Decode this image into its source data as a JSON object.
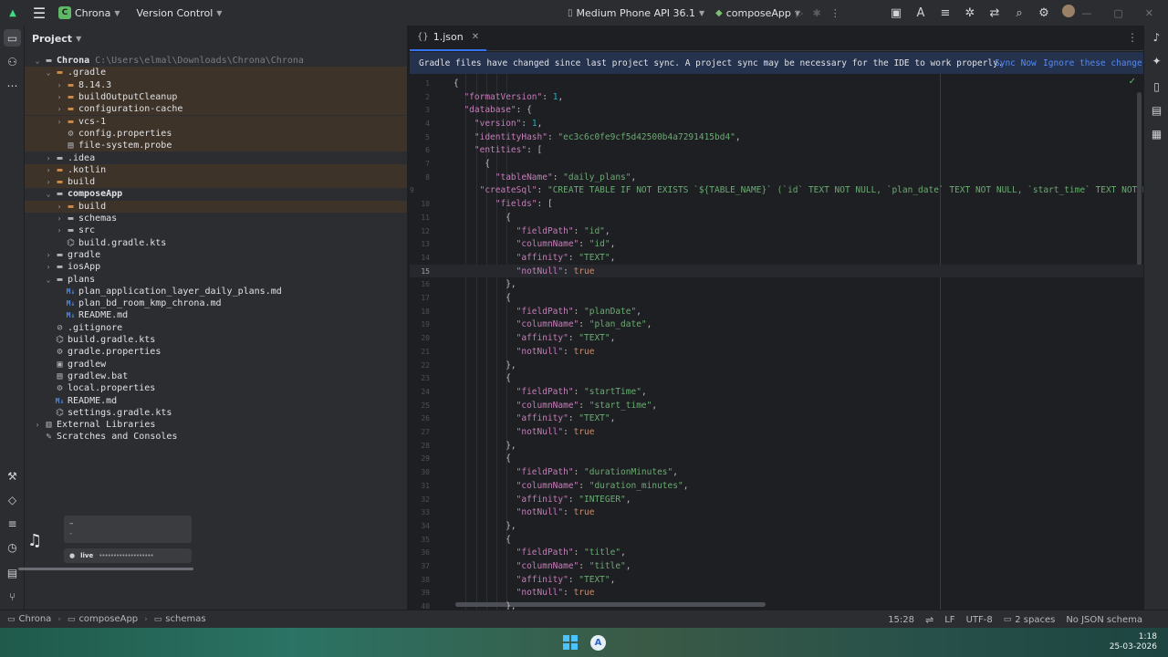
{
  "titlebar": {
    "project_badge": "C",
    "project_name": "Chrona",
    "version_control": "Version Control",
    "device": "Medium Phone API 36.1",
    "run_config": "composeApp"
  },
  "project_panel": {
    "title": "Project",
    "root_label": "Chrona",
    "root_path": "C:\\Users\\elmal\\Downloads\\Chrona\\Chrona",
    "items": [
      {
        "label": ".gradle",
        "indent": 2,
        "type": "folder-orange",
        "expanded": true,
        "ignored": true
      },
      {
        "label": "8.14.3",
        "indent": 3,
        "type": "folder-orange",
        "expanded": false,
        "ignored": true
      },
      {
        "label": "buildOutputCleanup",
        "indent": 3,
        "type": "folder-orange",
        "expanded": false,
        "ignored": true
      },
      {
        "label": "configuration-cache",
        "indent": 3,
        "type": "folder-orange",
        "expanded": false,
        "ignored": true
      },
      {
        "label": "vcs-1",
        "indent": 3,
        "type": "folder-orange",
        "expanded": false,
        "ignored": true
      },
      {
        "label": "config.properties",
        "indent": 3,
        "type": "gear",
        "ignored": true
      },
      {
        "label": "file-system.probe",
        "indent": 3,
        "type": "file",
        "ignored": true
      },
      {
        "label": ".idea",
        "indent": 2,
        "type": "folder",
        "expanded": false
      },
      {
        "label": ".kotlin",
        "indent": 2,
        "type": "folder-orange",
        "expanded": false,
        "ignored": true
      },
      {
        "label": "build",
        "indent": 2,
        "type": "folder-orange",
        "expanded": false,
        "ignored": true
      },
      {
        "label": "composeApp",
        "indent": 2,
        "type": "folder",
        "expanded": true,
        "bold": true
      },
      {
        "label": "build",
        "indent": 3,
        "type": "folder-orange",
        "expanded": false,
        "ignored": true
      },
      {
        "label": "schemas",
        "indent": 3,
        "type": "folder",
        "expanded": false
      },
      {
        "label": "src",
        "indent": 3,
        "type": "folder",
        "expanded": false
      },
      {
        "label": "build.gradle.kts",
        "indent": 3,
        "type": "gradle"
      },
      {
        "label": "gradle",
        "indent": 2,
        "type": "folder",
        "expanded": false
      },
      {
        "label": "iosApp",
        "indent": 2,
        "type": "folder",
        "expanded": false
      },
      {
        "label": "plans",
        "indent": 2,
        "type": "folder",
        "expanded": true
      },
      {
        "label": "plan_application_layer_daily_plans.md",
        "indent": 3,
        "type": "md"
      },
      {
        "label": "plan_bd_room_kmp_chrona.md",
        "indent": 3,
        "type": "md"
      },
      {
        "label": "README.md",
        "indent": 3,
        "type": "md"
      },
      {
        "label": ".gitignore",
        "indent": 2,
        "type": "ignore"
      },
      {
        "label": "build.gradle.kts",
        "indent": 2,
        "type": "gradle"
      },
      {
        "label": "gradle.properties",
        "indent": 2,
        "type": "gear"
      },
      {
        "label": "gradlew",
        "indent": 2,
        "type": "term"
      },
      {
        "label": "gradlew.bat",
        "indent": 2,
        "type": "file"
      },
      {
        "label": "local.properties",
        "indent": 2,
        "type": "gear"
      },
      {
        "label": "README.md",
        "indent": 2,
        "type": "md"
      },
      {
        "label": "settings.gradle.kts",
        "indent": 2,
        "type": "gradle"
      },
      {
        "label": "External Libraries",
        "indent": 1,
        "type": "lib",
        "expanded": false
      },
      {
        "label": "Scratches and Consoles",
        "indent": 1,
        "type": "scratch"
      }
    ]
  },
  "media_widget": {
    "line1": "–",
    "line2": "-",
    "live_label": "live",
    "live_dots": "•••••••••••••••••••"
  },
  "editor": {
    "tab_label": "1.json",
    "banner_text": "Gradle files have changed since last project sync. A project sync may be necessary for the IDE to work properly.",
    "banner_sync": "Sync Now",
    "banner_ignore": "Ignore these change",
    "current_line": 15,
    "lines": [
      [
        [
          "p",
          "{"
        ]
      ],
      [
        [
          "p",
          "  "
        ],
        [
          "k",
          "\"formatVersion\""
        ],
        [
          "p",
          ": "
        ],
        [
          "n",
          "1"
        ],
        [
          "p",
          ","
        ]
      ],
      [
        [
          "p",
          "  "
        ],
        [
          "k",
          "\"database\""
        ],
        [
          "p",
          ": {"
        ]
      ],
      [
        [
          "p",
          "    "
        ],
        [
          "k",
          "\"version\""
        ],
        [
          "p",
          ": "
        ],
        [
          "n",
          "1"
        ],
        [
          "p",
          ","
        ]
      ],
      [
        [
          "p",
          "    "
        ],
        [
          "k",
          "\"identityHash\""
        ],
        [
          "p",
          ": "
        ],
        [
          "s",
          "\"ec3c6c0fe9cf5d42500b4a7291415bd4\""
        ],
        [
          "p",
          ","
        ]
      ],
      [
        [
          "p",
          "    "
        ],
        [
          "k",
          "\"entities\""
        ],
        [
          "p",
          ": ["
        ]
      ],
      [
        [
          "p",
          "      {"
        ]
      ],
      [
        [
          "p",
          "        "
        ],
        [
          "k",
          "\"tableName\""
        ],
        [
          "p",
          ": "
        ],
        [
          "s",
          "\"daily_plans\""
        ],
        [
          "p",
          ","
        ]
      ],
      [
        [
          "p",
          "        "
        ],
        [
          "k",
          "\"createSql\""
        ],
        [
          "p",
          ": "
        ],
        [
          "s",
          "\"CREATE TABLE IF NOT EXISTS `${TABLE_NAME}` (`id` TEXT NOT NULL, `plan_date` TEXT NOT NULL, `start_time` TEXT NOT NULL, `"
        ]
      ],
      [
        [
          "p",
          "        "
        ],
        [
          "k",
          "\"fields\""
        ],
        [
          "p",
          ": ["
        ]
      ],
      [
        [
          "p",
          "          {"
        ]
      ],
      [
        [
          "p",
          "            "
        ],
        [
          "k",
          "\"fieldPath\""
        ],
        [
          "p",
          ": "
        ],
        [
          "s",
          "\"id\""
        ],
        [
          "p",
          ","
        ]
      ],
      [
        [
          "p",
          "            "
        ],
        [
          "k",
          "\"columnName\""
        ],
        [
          "p",
          ": "
        ],
        [
          "s",
          "\"id\""
        ],
        [
          "p",
          ","
        ]
      ],
      [
        [
          "p",
          "            "
        ],
        [
          "k",
          "\"affinity\""
        ],
        [
          "p",
          ": "
        ],
        [
          "s",
          "\"TEXT\""
        ],
        [
          "p",
          ","
        ]
      ],
      [
        [
          "p",
          "            "
        ],
        [
          "k",
          "\"notNull\""
        ],
        [
          "p",
          ": "
        ],
        [
          "kw",
          "true"
        ]
      ],
      [
        [
          "p",
          "          },"
        ]
      ],
      [
        [
          "p",
          "          {"
        ]
      ],
      [
        [
          "p",
          "            "
        ],
        [
          "k",
          "\"fieldPath\""
        ],
        [
          "p",
          ": "
        ],
        [
          "s",
          "\"planDate\""
        ],
        [
          "p",
          ","
        ]
      ],
      [
        [
          "p",
          "            "
        ],
        [
          "k",
          "\"columnName\""
        ],
        [
          "p",
          ": "
        ],
        [
          "s",
          "\"plan_date\""
        ],
        [
          "p",
          ","
        ]
      ],
      [
        [
          "p",
          "            "
        ],
        [
          "k",
          "\"affinity\""
        ],
        [
          "p",
          ": "
        ],
        [
          "s",
          "\"TEXT\""
        ],
        [
          "p",
          ","
        ]
      ],
      [
        [
          "p",
          "            "
        ],
        [
          "k",
          "\"notNull\""
        ],
        [
          "p",
          ": "
        ],
        [
          "kw",
          "true"
        ]
      ],
      [
        [
          "p",
          "          },"
        ]
      ],
      [
        [
          "p",
          "          {"
        ]
      ],
      [
        [
          "p",
          "            "
        ],
        [
          "k",
          "\"fieldPath\""
        ],
        [
          "p",
          ": "
        ],
        [
          "s",
          "\"startTime\""
        ],
        [
          "p",
          ","
        ]
      ],
      [
        [
          "p",
          "            "
        ],
        [
          "k",
          "\"columnName\""
        ],
        [
          "p",
          ": "
        ],
        [
          "s",
          "\"start_time\""
        ],
        [
          "p",
          ","
        ]
      ],
      [
        [
          "p",
          "            "
        ],
        [
          "k",
          "\"affinity\""
        ],
        [
          "p",
          ": "
        ],
        [
          "s",
          "\"TEXT\""
        ],
        [
          "p",
          ","
        ]
      ],
      [
        [
          "p",
          "            "
        ],
        [
          "k",
          "\"notNull\""
        ],
        [
          "p",
          ": "
        ],
        [
          "kw",
          "true"
        ]
      ],
      [
        [
          "p",
          "          },"
        ]
      ],
      [
        [
          "p",
          "          {"
        ]
      ],
      [
        [
          "p",
          "            "
        ],
        [
          "k",
          "\"fieldPath\""
        ],
        [
          "p",
          ": "
        ],
        [
          "s",
          "\"durationMinutes\""
        ],
        [
          "p",
          ","
        ]
      ],
      [
        [
          "p",
          "            "
        ],
        [
          "k",
          "\"columnName\""
        ],
        [
          "p",
          ": "
        ],
        [
          "s",
          "\"duration_minutes\""
        ],
        [
          "p",
          ","
        ]
      ],
      [
        [
          "p",
          "            "
        ],
        [
          "k",
          "\"affinity\""
        ],
        [
          "p",
          ": "
        ],
        [
          "s",
          "\"INTEGER\""
        ],
        [
          "p",
          ","
        ]
      ],
      [
        [
          "p",
          "            "
        ],
        [
          "k",
          "\"notNull\""
        ],
        [
          "p",
          ": "
        ],
        [
          "kw",
          "true"
        ]
      ],
      [
        [
          "p",
          "          },"
        ]
      ],
      [
        [
          "p",
          "          {"
        ]
      ],
      [
        [
          "p",
          "            "
        ],
        [
          "k",
          "\"fieldPath\""
        ],
        [
          "p",
          ": "
        ],
        [
          "s",
          "\"title\""
        ],
        [
          "p",
          ","
        ]
      ],
      [
        [
          "p",
          "            "
        ],
        [
          "k",
          "\"columnName\""
        ],
        [
          "p",
          ": "
        ],
        [
          "s",
          "\"title\""
        ],
        [
          "p",
          ","
        ]
      ],
      [
        [
          "p",
          "            "
        ],
        [
          "k",
          "\"affinity\""
        ],
        [
          "p",
          ": "
        ],
        [
          "s",
          "\"TEXT\""
        ],
        [
          "p",
          ","
        ]
      ],
      [
        [
          "p",
          "            "
        ],
        [
          "k",
          "\"notNull\""
        ],
        [
          "p",
          ": "
        ],
        [
          "kw",
          "true"
        ]
      ],
      [
        [
          "p",
          "          },"
        ]
      ]
    ]
  },
  "statusbar": {
    "breadcrumb": [
      "Chrona",
      "composeApp",
      "schemas"
    ],
    "position": "15:28",
    "line_ending": "LF",
    "encoding": "UTF-8",
    "indent": "2 spaces",
    "schema": "No JSON schema"
  },
  "taskbar": {
    "time": "1:18",
    "date": "25-03-2026"
  },
  "colors": {
    "accent": "#3574f0",
    "json_key": "#c77dbb",
    "json_string": "#6aab73",
    "json_number": "#2aacb8",
    "json_keyword": "#cf8e6d",
    "ignored_row": "#3d3328",
    "banner_bg": "#25324d"
  }
}
